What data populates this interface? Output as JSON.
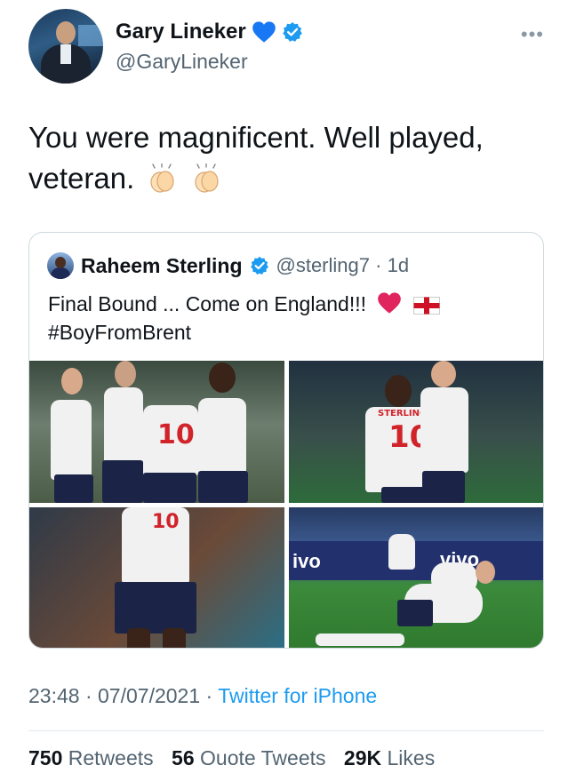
{
  "author": {
    "display_name": "Gary Lineker",
    "handle": "@GaryLineker",
    "name_emoji": "blue-heart-icon",
    "verified": true
  },
  "tweet": {
    "text_line1": "You were magnificent. Well played,",
    "text_line2": "veteran.",
    "emojis": [
      "clapping-hands-icon",
      "clapping-hands-icon"
    ]
  },
  "quoted_tweet": {
    "display_name": "Raheem Sterling",
    "handle": "@sterling7",
    "separator": "·",
    "age": "1d",
    "verified": true,
    "text_line1": "Final Bound ... Come on England!!!",
    "text_line2": "#BoyFromBrent",
    "emojis": [
      "red-heart-icon",
      "england-flag-icon"
    ],
    "photos": [
      {
        "name": "photo-team-celebration",
        "shirt_number": "10"
      },
      {
        "name": "photo-sterling-kane-embrace",
        "shirt_number": "10",
        "shirt_name": "STERLING"
      },
      {
        "name": "photo-sterling-number-10",
        "shirt_number": "10"
      },
      {
        "name": "photo-players-pile-on",
        "board_text_1": "ivo",
        "board_text_2": "vivo"
      }
    ]
  },
  "meta": {
    "time": "23:48",
    "dot": "·",
    "date": "07/07/2021",
    "source": "Twitter for iPhone"
  },
  "stats": {
    "retweets_count": "750",
    "retweets_label": "Retweets",
    "quotes_count": "56",
    "quotes_label": "Quote Tweets",
    "likes_count": "29K",
    "likes_label": "Likes"
  },
  "colors": {
    "verified_blue": "#1d9bf0",
    "heart_blue": "#1877f2",
    "link_blue": "#1d9bf0",
    "muted_text": "#536471"
  }
}
